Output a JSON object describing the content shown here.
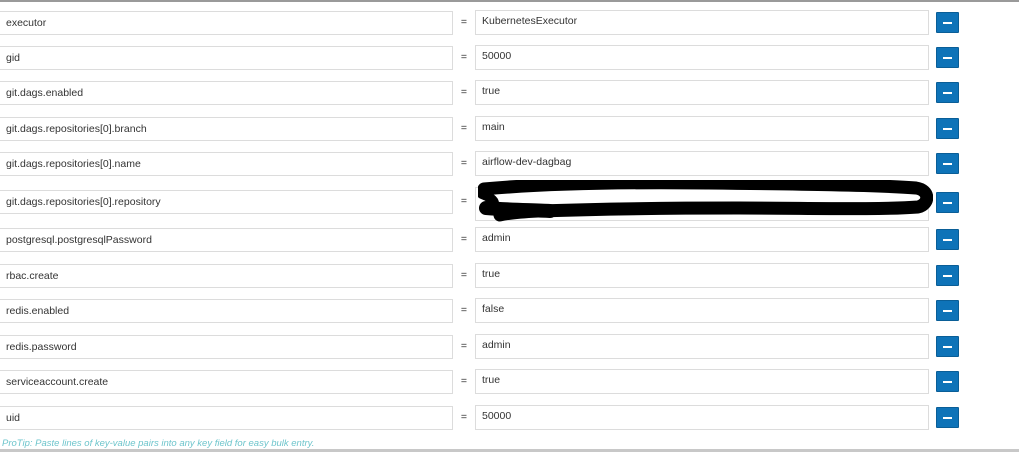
{
  "rows": [
    {
      "key": "executor",
      "value": "KubernetesExecutor"
    },
    {
      "key": "gid",
      "value": "50000"
    },
    {
      "key": "git.dags.enabled",
      "value": "true"
    },
    {
      "key": "git.dags.repositories[0].branch",
      "value": "main"
    },
    {
      "key": "git.dags.repositories[0].name",
      "value": "airflow-dev-dagbag"
    },
    {
      "key": "git.dags.repositories[0].repository",
      "value": ""
    },
    {
      "key": "postgresql.postgresqlPassword",
      "value": "admin"
    },
    {
      "key": "rbac.create",
      "value": "true"
    },
    {
      "key": "redis.enabled",
      "value": "false"
    },
    {
      "key": "redis.password",
      "value": "admin"
    },
    {
      "key": "serviceaccount.create",
      "value": "true"
    },
    {
      "key": "uid",
      "value": "50000"
    }
  ],
  "separator": "=",
  "remove_icon": "minus-icon",
  "protip": "ProTip: Paste lines of key-value pairs into any key field for easy bulk entry.",
  "colors": {
    "button": "#0e73b8",
    "protip": "#6ec5cc"
  }
}
